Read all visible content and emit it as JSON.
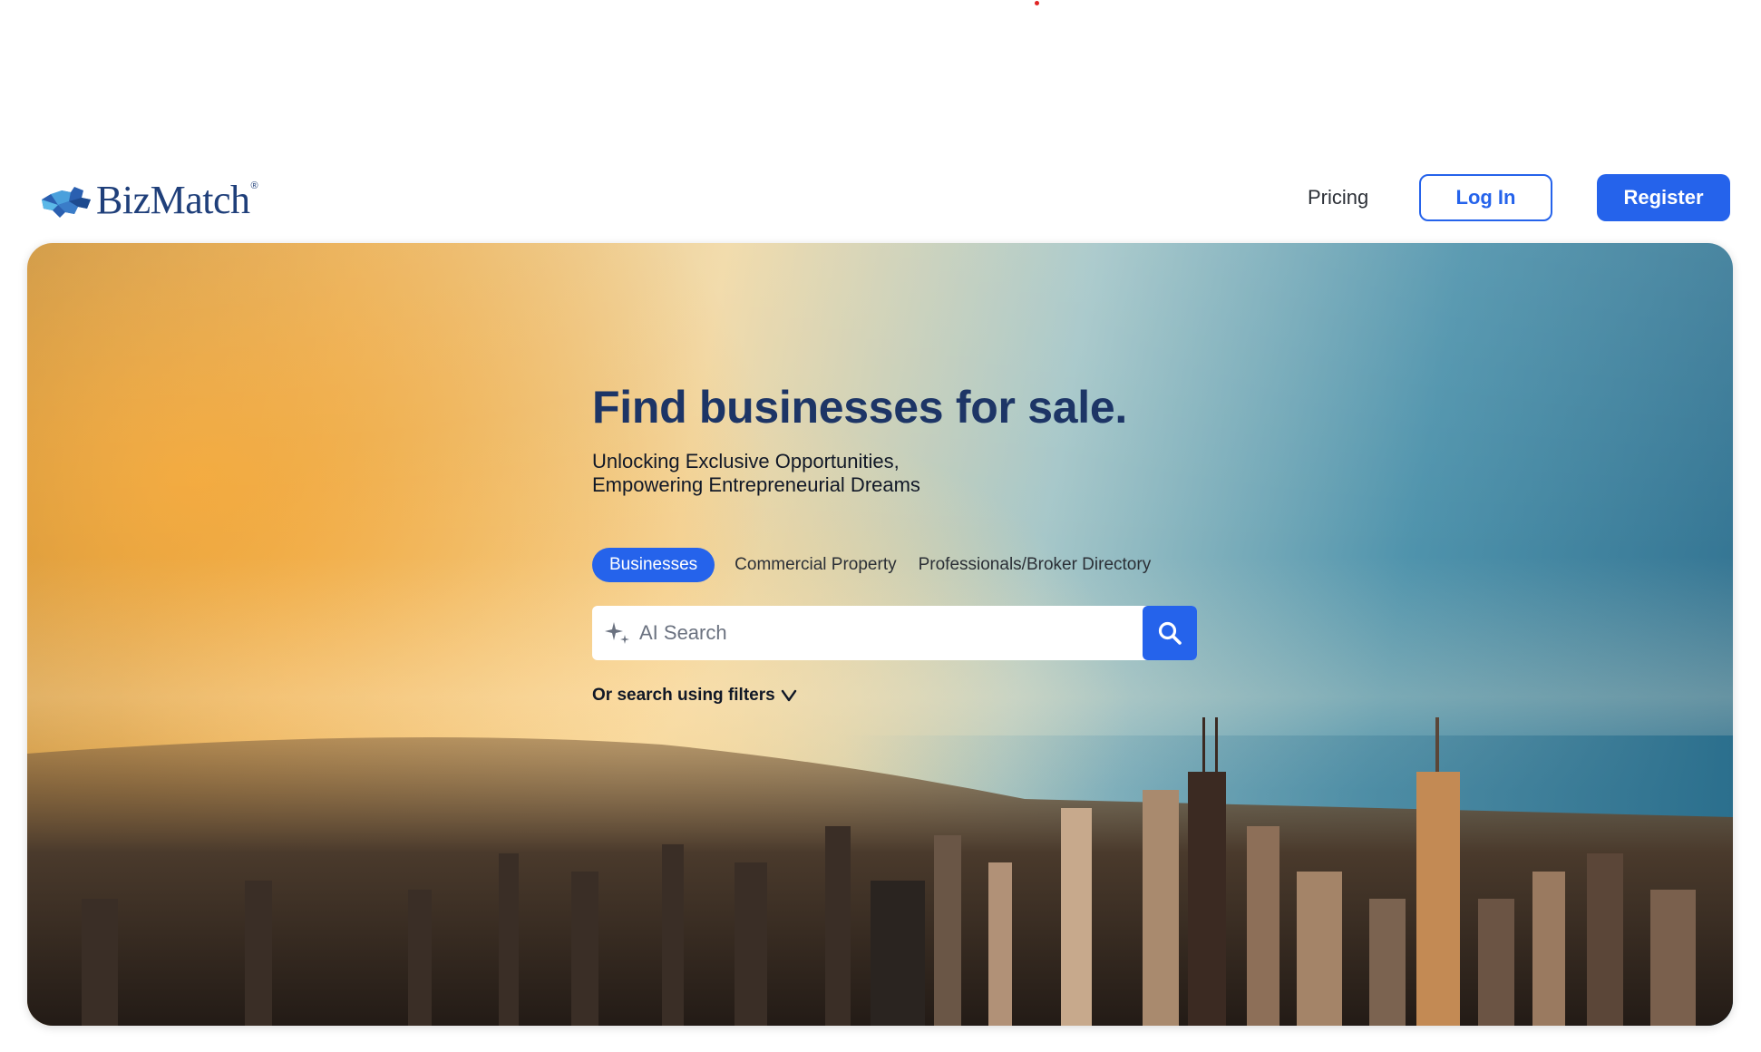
{
  "brand": {
    "name": "BizMatch",
    "reg_mark": "®",
    "color": "#1f3f7a"
  },
  "nav": {
    "pricing": "Pricing",
    "login": "Log In",
    "register": "Register",
    "accent": "#2563eb"
  },
  "hero": {
    "title": "Find businesses for sale.",
    "subtitle_line1": "Unlocking Exclusive Opportunities,",
    "subtitle_line2": "Empowering Entrepreneurial Dreams",
    "tabs": [
      {
        "label": "Businesses",
        "active": true
      },
      {
        "label": "Commercial Property",
        "active": false
      },
      {
        "label": "Professionals/Broker Directory",
        "active": false
      }
    ],
    "search": {
      "placeholder": "AI Search",
      "icon": "sparkle-icon",
      "button_icon": "search-icon"
    },
    "filters_link": "Or search using filters",
    "filters_icon": "chevron-down-icon"
  }
}
